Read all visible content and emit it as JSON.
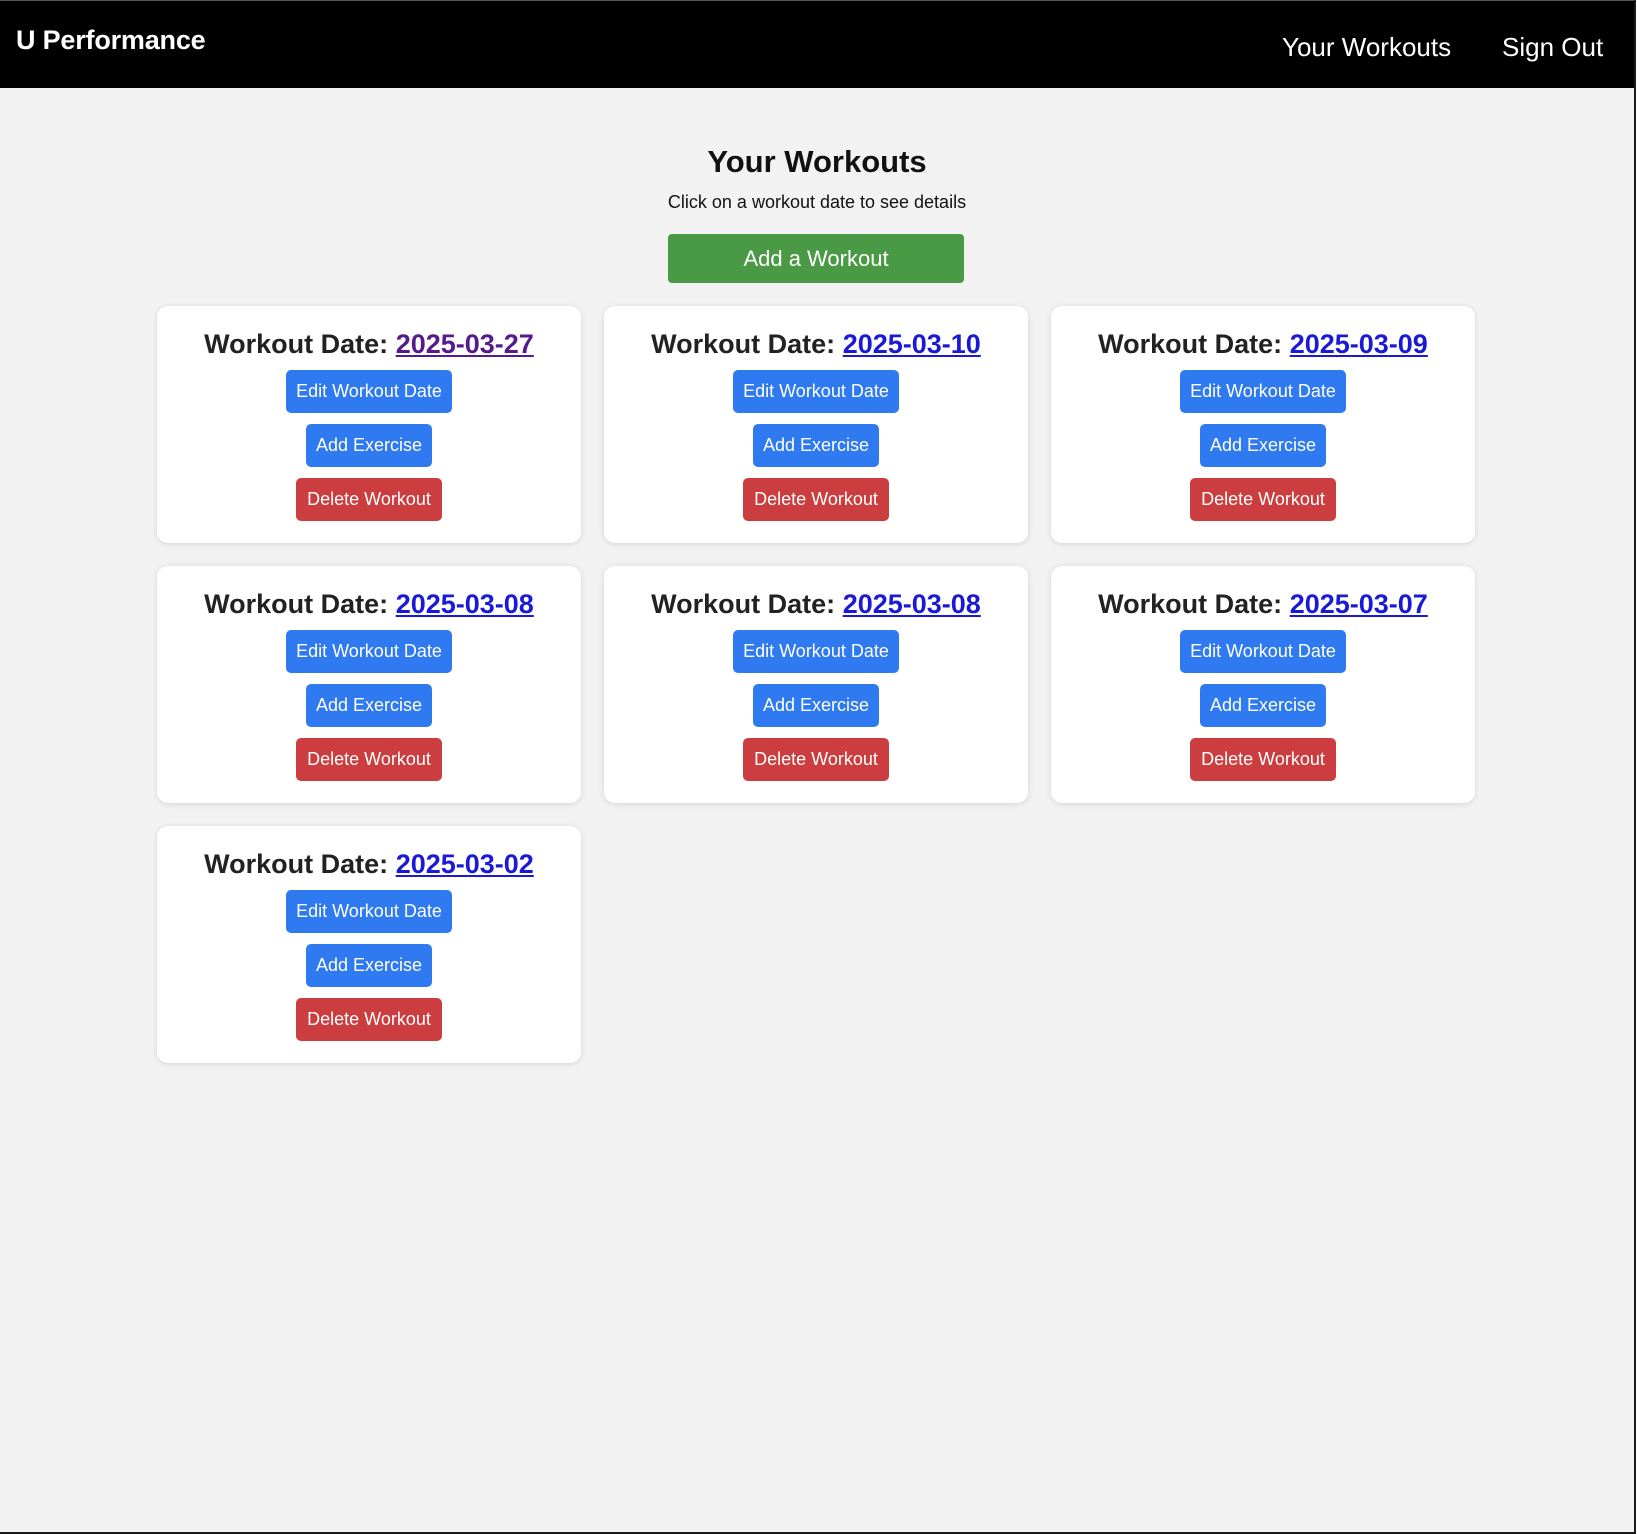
{
  "navbar": {
    "brand": "U Performance",
    "links": [
      "Your Workouts",
      "Sign Out"
    ]
  },
  "main": {
    "title": "Your Workouts",
    "subtitle": "Click on a workout date to see details",
    "add_workout_label": "Add a Workout"
  },
  "card_labels": {
    "date_prefix": "Workout Date: ",
    "edit": "Edit Workout Date",
    "add_exercise": "Add Exercise",
    "delete": "Delete Workout"
  },
  "workouts": [
    {
      "date": "2025-03-27",
      "visited": true
    },
    {
      "date": "2025-03-10",
      "visited": false
    },
    {
      "date": "2025-03-09",
      "visited": false
    },
    {
      "date": "2025-03-08",
      "visited": false
    },
    {
      "date": "2025-03-08",
      "visited": false
    },
    {
      "date": "2025-03-07",
      "visited": false
    },
    {
      "date": "2025-03-02",
      "visited": false
    }
  ],
  "colors": {
    "navbar_bg": "#000000",
    "page_bg": "#f2f2f2",
    "add_workout_bg": "#4a9a45",
    "primary_button": "#2f7af0",
    "danger_button": "#cc3d3f",
    "link": "#1a1ad6",
    "visited_link": "#551a8b"
  }
}
